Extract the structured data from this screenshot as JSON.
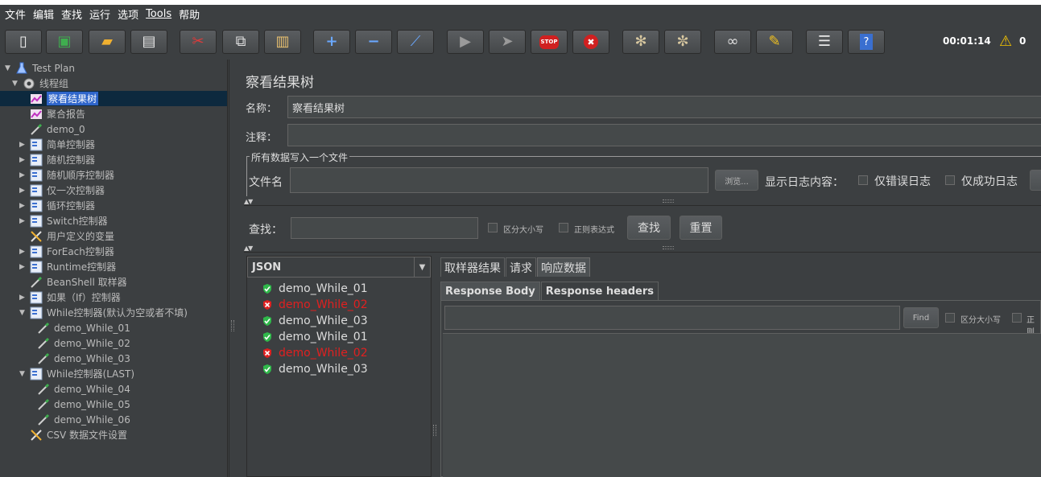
{
  "menubar": {
    "items": [
      "文件",
      "编辑",
      "查找",
      "运行",
      "选项",
      "Tools",
      "帮助"
    ]
  },
  "toolbar": {
    "buttons": [
      {
        "name": "new-icon",
        "glyph": "📄"
      },
      {
        "name": "templates-icon",
        "glyph": "🗂"
      },
      {
        "name": "open-icon",
        "glyph": "📂"
      },
      {
        "name": "save-icon",
        "glyph": "💾"
      },
      {
        "name": "cut-icon",
        "glyph": "✂"
      },
      {
        "name": "copy-icon",
        "glyph": "⧉"
      },
      {
        "name": "paste-icon",
        "glyph": "📋"
      },
      {
        "name": "expand-icon",
        "glyph": "+"
      },
      {
        "name": "collapse-icon",
        "glyph": "−"
      },
      {
        "name": "toggle-icon",
        "glyph": "⁄"
      },
      {
        "name": "start-icon",
        "glyph": "▶"
      },
      {
        "name": "start-no-pause-icon",
        "glyph": "⯈"
      },
      {
        "name": "stop-icon",
        "glyph": "STOP"
      },
      {
        "name": "shutdown-icon",
        "glyph": "✖"
      },
      {
        "name": "clear-icon",
        "glyph": "⚙"
      },
      {
        "name": "clear-all-icon",
        "glyph": "⚙"
      },
      {
        "name": "search-icon",
        "glyph": "🔭"
      },
      {
        "name": "reset-search-icon",
        "glyph": "🧹"
      },
      {
        "name": "function-helper-icon",
        "glyph": "☰"
      },
      {
        "name": "help-icon",
        "glyph": "?"
      }
    ],
    "elapsed": "00:01:14",
    "warning_count": "0"
  },
  "tree": {
    "items": [
      {
        "label": "Test Plan",
        "icon": "flask-icon",
        "arrow": "▼",
        "depth": 0
      },
      {
        "label": "线程组",
        "icon": "gear-icon",
        "arrow": "▼",
        "depth": 1
      },
      {
        "label": "察看结果树",
        "icon": "chart-icon",
        "arrow": "",
        "depth": 2,
        "selected": true
      },
      {
        "label": "聚合报告",
        "icon": "chart-icon",
        "arrow": "",
        "depth": 2
      },
      {
        "label": "demo_0",
        "icon": "pipette-icon",
        "arrow": "",
        "depth": 2
      },
      {
        "label": "简单控制器",
        "icon": "controller-icon",
        "arrow": "▶",
        "depth": 2
      },
      {
        "label": "随机控制器",
        "icon": "controller-icon",
        "arrow": "▶",
        "depth": 2
      },
      {
        "label": "随机顺序控制器",
        "icon": "controller-icon",
        "arrow": "▶",
        "depth": 2
      },
      {
        "label": "仅一次控制器",
        "icon": "controller-icon",
        "arrow": "▶",
        "depth": 2
      },
      {
        "label": "循环控制器",
        "icon": "controller-icon",
        "arrow": "▶",
        "depth": 2
      },
      {
        "label": "Switch控制器",
        "icon": "controller-icon",
        "arrow": "▶",
        "depth": 2
      },
      {
        "label": "用户定义的变量",
        "icon": "wrench-icon",
        "arrow": "",
        "depth": 2
      },
      {
        "label": "ForEach控制器",
        "icon": "controller-icon",
        "arrow": "▶",
        "depth": 2
      },
      {
        "label": "Runtime控制器",
        "icon": "controller-icon",
        "arrow": "▶",
        "depth": 2
      },
      {
        "label": "BeanShell 取样器",
        "icon": "pipette-icon",
        "arrow": "",
        "depth": 2
      },
      {
        "label": "如果（If）控制器",
        "icon": "controller-icon",
        "arrow": "▶",
        "depth": 2
      },
      {
        "label": "While控制器(默认为空或者不填)",
        "icon": "controller-icon",
        "arrow": "▼",
        "depth": 2
      },
      {
        "label": "demo_While_01",
        "icon": "pipette-icon",
        "arrow": "",
        "depth": 3
      },
      {
        "label": "demo_While_02",
        "icon": "pipette-icon",
        "arrow": "",
        "depth": 3
      },
      {
        "label": "demo_While_03",
        "icon": "pipette-icon",
        "arrow": "",
        "depth": 3
      },
      {
        "label": "While控制器(LAST)",
        "icon": "controller-icon",
        "arrow": "▼",
        "depth": 2
      },
      {
        "label": "demo_While_04",
        "icon": "pipette-icon",
        "arrow": "",
        "depth": 3
      },
      {
        "label": "demo_While_05",
        "icon": "pipette-icon",
        "arrow": "",
        "depth": 3
      },
      {
        "label": "demo_While_06",
        "icon": "pipette-icon",
        "arrow": "",
        "depth": 3
      },
      {
        "label": "CSV 数据文件设置",
        "icon": "wrench-icon",
        "arrow": "",
        "depth": 2
      }
    ]
  },
  "main": {
    "title": "察看结果树",
    "name_label": "名称：",
    "name_value": "察看结果树",
    "comment_label": "注释：",
    "comment_value": "",
    "fieldset_legend": "所有数据写入一个文件",
    "filename_label": "文件名",
    "filename_value": "",
    "browse_label": "浏览...",
    "log_content_label": "显示日志内容：",
    "errors_only_label": "仅错误日志",
    "success_only_label": "仅成功日志",
    "search_label": "查找：",
    "search_value": "",
    "case_sensitive_label": "区分大小写",
    "regex_label": "正则表达式",
    "find_button": "查找",
    "reset_button": "重置"
  },
  "results": {
    "renderer": "JSON",
    "items": [
      {
        "label": "demo_While_01",
        "status": "success"
      },
      {
        "label": "demo_While_02",
        "status": "fail"
      },
      {
        "label": "demo_While_03",
        "status": "success"
      },
      {
        "label": "demo_While_01",
        "status": "success"
      },
      {
        "label": "demo_While_02",
        "status": "fail"
      },
      {
        "label": "demo_While_03",
        "status": "success"
      }
    ]
  },
  "detail": {
    "tabs": [
      "取样器结果",
      "请求",
      "响应数据"
    ],
    "active_tab": 2,
    "subtabs": [
      "Response Body",
      "Response headers"
    ],
    "active_subtab": 0,
    "find_value": "",
    "find_button": "Find",
    "case_sensitive_label": "区分大小写",
    "regex_label_partial": "正则"
  },
  "colors": {
    "success": "#2fb84a",
    "fail": "#e02020",
    "selection": "#2f65ca"
  }
}
